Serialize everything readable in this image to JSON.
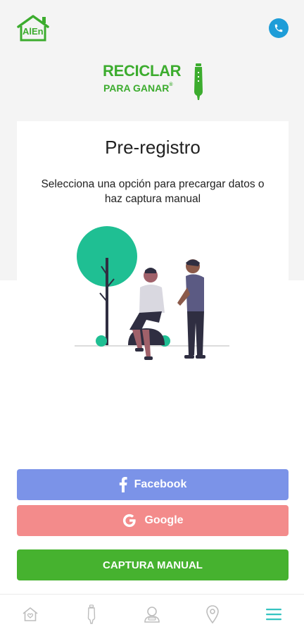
{
  "header": {
    "logo_text": "AlEn",
    "phone_icon": "phone-icon"
  },
  "brand": {
    "line1": "RECICLAR",
    "line2": "PARA GANAR",
    "registered_mark": "®"
  },
  "card": {
    "title": "Pre-registro",
    "subtitle": "Selecciona una opción para precargar datos o haz captura manual"
  },
  "buttons": {
    "facebook": "Facebook",
    "google": "Google",
    "manual": "CAPTURA MANUAL"
  },
  "bottom_nav": {
    "items": [
      "home-icon",
      "bottle-icon",
      "user-icon",
      "location-icon",
      "menu-icon"
    ],
    "active": "menu-icon"
  },
  "colors": {
    "brand_green": "#3cac2e",
    "phone_blue": "#1e9dd8",
    "facebook": "#7b93e8",
    "google": "#f38b8b",
    "manual": "#46b22f",
    "tree": "#1fbf93",
    "nav_inactive": "#bdbdbd",
    "nav_active": "#33c3c0"
  }
}
